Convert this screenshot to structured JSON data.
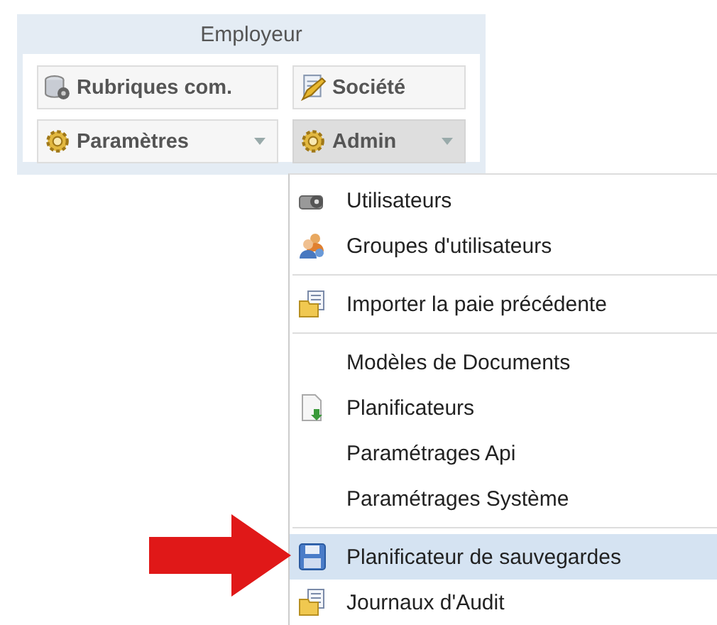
{
  "panel": {
    "title": "Employeur",
    "buttons": [
      {
        "label": "Rubriques com.",
        "dropdown": false,
        "selected": false
      },
      {
        "label": "Société",
        "dropdown": false,
        "selected": false
      },
      {
        "label": "Paramètres",
        "dropdown": true,
        "selected": false
      },
      {
        "label": "Admin",
        "dropdown": true,
        "selected": true
      }
    ]
  },
  "menu": {
    "items": [
      {
        "kind": "item",
        "label": "Utilisateurs",
        "selected": false
      },
      {
        "kind": "item",
        "label": "Groupes d'utilisateurs",
        "selected": false
      },
      {
        "kind": "separator"
      },
      {
        "kind": "item",
        "label": "Importer la paie précédente",
        "selected": false
      },
      {
        "kind": "separator"
      },
      {
        "kind": "item",
        "label": "Modèles de Documents",
        "selected": false
      },
      {
        "kind": "item",
        "label": "Planificateurs",
        "selected": false
      },
      {
        "kind": "item",
        "label": "Paramétrages Api",
        "selected": false
      },
      {
        "kind": "item",
        "label": "Paramétrages Système",
        "selected": false
      },
      {
        "kind": "separator"
      },
      {
        "kind": "item",
        "label": "Planificateur de sauvegardes",
        "selected": true
      },
      {
        "kind": "item",
        "label": "Journaux d'Audit",
        "selected": false
      }
    ]
  }
}
